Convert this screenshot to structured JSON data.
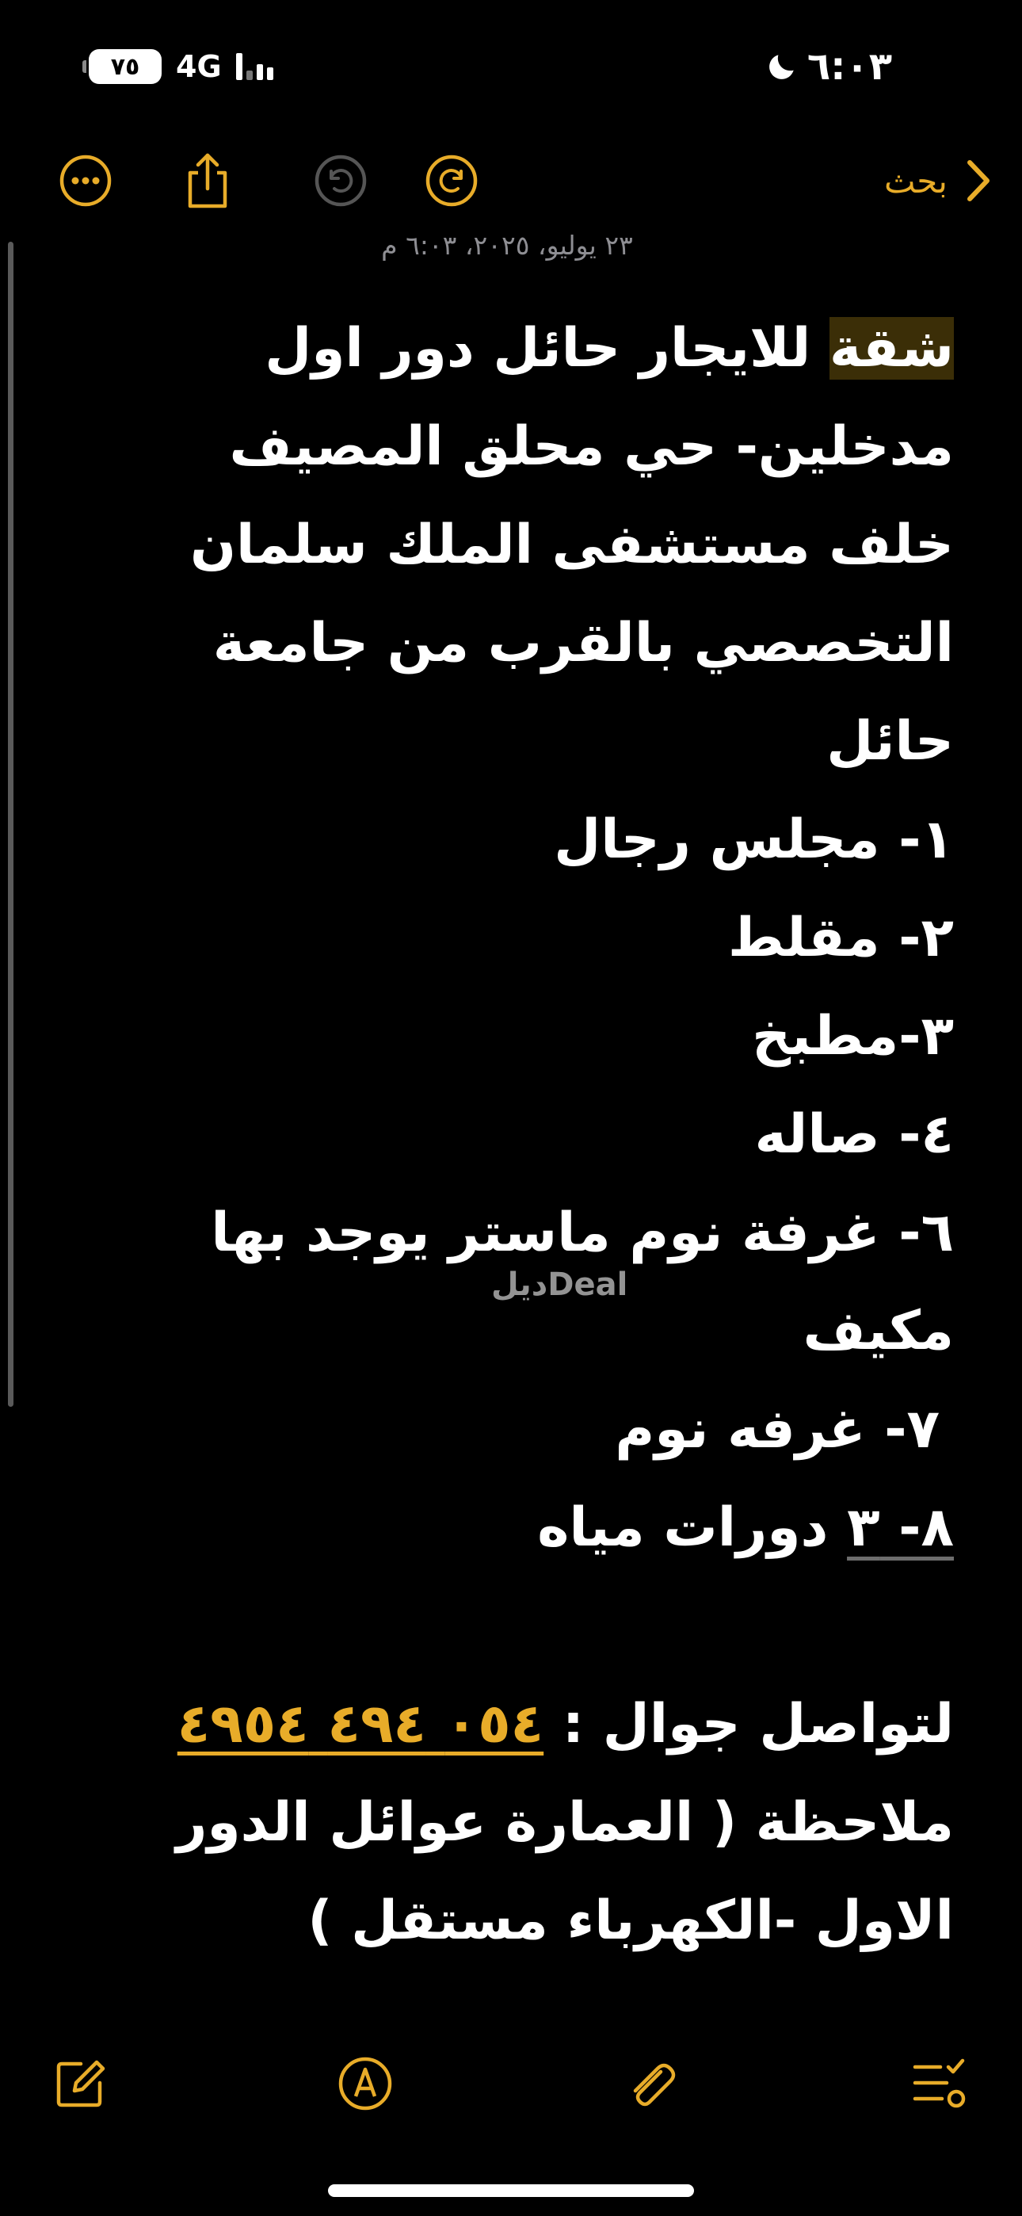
{
  "status_bar": {
    "time": "٦:٠٣",
    "battery": "٧٥",
    "network": "4G"
  },
  "toolbar": {
    "back_label": "بحث"
  },
  "note": {
    "date": "٢٣ يوليو، ٢٠٢٥، ٦:٠٣ م",
    "highlighted_word": "شقة",
    "title_rest": " للايجار حائل دور اول",
    "lines": [
      "مدخلين- حي محلق  المصيف",
      "خلف مستشفى الملك سلمان",
      "التخصصي  بالقرب من جامعة",
      "حائل",
      "١-   مجلس رجال",
      "٢-  مقلط",
      "٣-مطبخ",
      "٤- صاله",
      "٦-   غرفة نوم ماستر يوجد بها",
      "مكيف",
      "٧-  غرفه نوم"
    ],
    "item_8_prefix": "٨- ٣",
    "item_8_rest": " دورات مياه",
    "contact_label": "لتواصل جوال : ",
    "phone": "٠٥٤ ٤٩٤ ٤٩٥٤",
    "note_lines": [
      "ملاحظة ( العمارة عوائل الدور",
      "الاول -الكهرباء مستقل )"
    ],
    "watermark": "ديلDeal"
  },
  "colors": {
    "accent": "#e8ac29",
    "background": "#000000",
    "highlight": "#3b2e07",
    "muted": "#8e8e93"
  }
}
